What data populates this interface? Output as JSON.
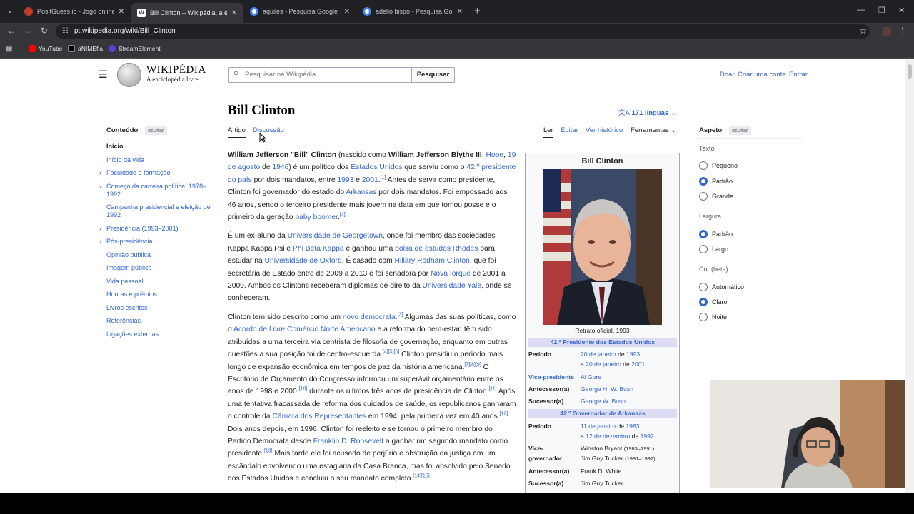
{
  "browser": {
    "tabs": [
      {
        "title": "PositGuess.io - Jogo online m...",
        "favicon_color": "#c0392b"
      },
      {
        "title": "Bill Clinton – Wikipédia, a encic",
        "favicon_color": "#ffffff"
      },
      {
        "title": "aquiles - Pesquisa Google",
        "favicon_color": "#4285f4"
      },
      {
        "title": "adelio bispo - Pesquisa Google",
        "favicon_color": "#4285f4"
      }
    ],
    "url": "pt.wikipedia.org/wiki/Bill_Clinton",
    "bookmarks": [
      {
        "label": "YouTube",
        "color": "#ff0000"
      },
      {
        "label": "aNIMEfla",
        "color": "#000000"
      },
      {
        "label": "StreamElement",
        "color": "#5b3fd6"
      }
    ]
  },
  "wiki": {
    "logo_word": "WIKIPÉDIA",
    "logo_tagline": "A enciclopédia livre",
    "search_placeholder": "Pesquisar na Wikipédia",
    "search_button": "Pesquisar",
    "user_links": [
      "Doar",
      "Criar uma conta",
      "Entrar"
    ],
    "title": "Bill Clinton",
    "languages": "171 línguas",
    "tabs_left": [
      "Artigo",
      "Discussão"
    ],
    "tabs_right": [
      "Ler",
      "Editar",
      "Ver histórico",
      "Ferramentas"
    ]
  },
  "toc": {
    "heading": "Conteúdo",
    "hide": "ocultar",
    "items": [
      "Início",
      "Início da vida",
      "Faculdade e formação",
      "Começo da carreira política: 1978–1992",
      "Campanha presidencial e eleição de 1992",
      "Presidência (1993–2001)",
      "Pós-presidência",
      "Opinião pública",
      "Imagem pública",
      "Vida pessoal",
      "Honras e prêmios",
      "Livros escritos",
      "Referências",
      "Ligações externas"
    ]
  },
  "appearance": {
    "heading": "Aspeto",
    "hide": "ocultar",
    "text_label": "Texto",
    "text_options": [
      "Pequeno",
      "Padrão",
      "Grande"
    ],
    "text_selected": "Padrão",
    "width_label": "Largura",
    "width_options": [
      "Padrão",
      "Largo"
    ],
    "width_selected": "Padrão",
    "color_label": "Cor (beta)",
    "color_options": [
      "Automático",
      "Claro",
      "Noite"
    ],
    "color_selected": "Claro"
  },
  "infobox": {
    "title": "Bill Clinton",
    "caption": "Retrato oficial, 1993",
    "band1": "42.º Presidente dos Estados Unidos",
    "periodo_label": "Período",
    "p1_a": "20 de janeiro",
    "p1_b": "1993",
    "p1_c": "20 de janeiro",
    "p1_d": "2001",
    "de": "de",
    "a": "a",
    "vp_label": "Vice-presidente",
    "vp_val": "Al Gore",
    "ant_label": "Antecessor(a)",
    "ant_val": "George H. W. Bush",
    "suc_label": "Sucessor(a)",
    "suc_val": "George W. Bush",
    "band2": "42.º Governador de Arkansas",
    "p2_a": "11 de janeiro",
    "p2_b": "1983",
    "p2_c": "12 de dezembro",
    "p2_d": "1992",
    "vg_label1": "Vice-",
    "vg_label2": "governador",
    "vg_1": "Winston Bryant",
    "vg_1d": "(1983–1991)",
    "vg_2": "Jim Guy Tucker",
    "vg_2d": "(1991–1992)",
    "ant2_val": "Frank D. White",
    "suc2_val": "Jim Guy Tucker"
  }
}
